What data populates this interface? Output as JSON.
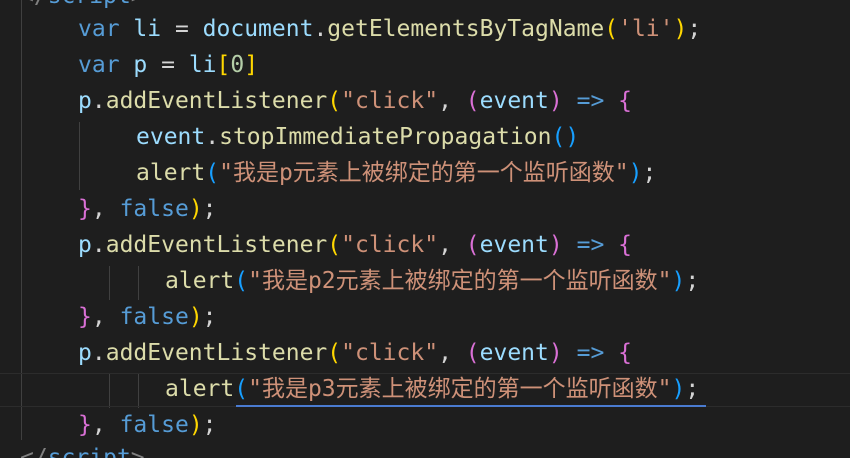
{
  "editor": {
    "colors": {
      "background": "#1e1e1e",
      "keyword": "#569cd6",
      "variable": "#9cdcfe",
      "function": "#dcdcaa",
      "string": "#ce9178",
      "number": "#b5cea8",
      "bracket_1": "#ffd700",
      "bracket_2": "#da70d6",
      "bracket_3": "#179fff"
    },
    "top_tag": {
      "open": "</",
      "name": "script",
      "close": ">"
    },
    "lines": {
      "l1": {
        "kw": "var",
        "name": "li",
        "eq": " = ",
        "obj": "document",
        "dot": ".",
        "method": "getElementsByTagName",
        "open": "(",
        "str": "'li'",
        "close": ")",
        "semi": ";"
      },
      "l2": {
        "kw": "var",
        "name": "p",
        "eq": " = ",
        "obj": "li",
        "open": "[",
        "num": "0",
        "close": "]"
      },
      "l3": {
        "obj": "p",
        "dot": ".",
        "method": "addEventListener",
        "open": "(",
        "str": "\"click\"",
        "comma": ", ",
        "popen": "(",
        "param": "event",
        "pclose": ")",
        "arrow": " => ",
        "brace": "{"
      },
      "l4": {
        "obj": "event",
        "dot": ".",
        "method": "stopImmediatePropagation",
        "open": "(",
        "close": ")"
      },
      "l5": {
        "method": "alert",
        "open": "(",
        "str": "\"我是p元素上被绑定的第一个监听函数\"",
        "close": ")",
        "semi": ";"
      },
      "l6": {
        "brace": "}",
        "comma": ", ",
        "kw": "false",
        "close": ")",
        "semi": ";"
      },
      "l7": {
        "obj": "p",
        "dot": ".",
        "method": "addEventListener",
        "open": "(",
        "str": "\"click\"",
        "comma": ", ",
        "popen": "(",
        "param": "event",
        "pclose": ")",
        "arrow": " => ",
        "brace": "{"
      },
      "l8": {
        "method": "alert",
        "open": "(",
        "str": "\"我是p2元素上被绑定的第一个监听函数\"",
        "close": ")",
        "semi": ";"
      },
      "l9": {
        "brace": "}",
        "comma": ", ",
        "kw": "false",
        "close": ")",
        "semi": ";"
      },
      "l10": {
        "obj": "p",
        "dot": ".",
        "method": "addEventListener",
        "open": "(",
        "str": "\"click\"",
        "comma": ", ",
        "popen": "(",
        "param": "event",
        "pclose": ")",
        "arrow": " => ",
        "brace": "{"
      },
      "l11": {
        "method": "alert",
        "open": "(",
        "str": "\"我是p3元素上被绑定的第一个监听函数\"",
        "close": ")",
        "semi": ";"
      },
      "l12": {
        "brace": "}",
        "comma": ", ",
        "kw": "false",
        "close": ")",
        "semi": ";"
      }
    },
    "bottom_tag": {
      "open": "</",
      "name": "script",
      "close": ">"
    }
  }
}
